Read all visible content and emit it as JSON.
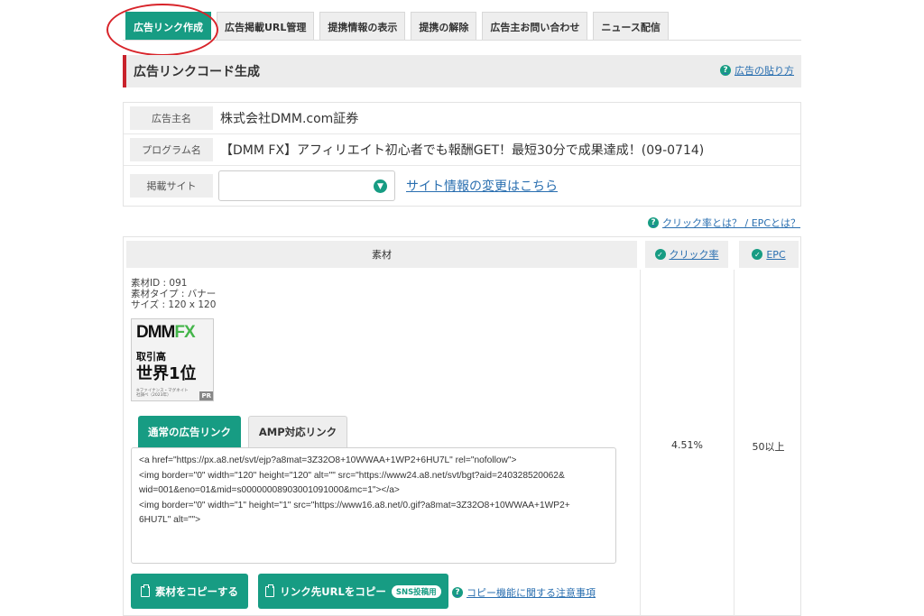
{
  "tabs": [
    {
      "label": "広告リンク作成",
      "active": true
    },
    {
      "label": "広告掲載URL管理"
    },
    {
      "label": "提携情報の表示"
    },
    {
      "label": "提携の解除"
    },
    {
      "label": "広告主お問い合わせ"
    },
    {
      "label": "ニュース配信"
    }
  ],
  "header": {
    "title": "広告リンクコード生成",
    "help_link": "広告の貼り方"
  },
  "info": {
    "advertiser_label": "広告主名",
    "advertiser_value": "株式会社DMM.com証券",
    "program_label": "プログラム名",
    "program_value": "【DMM FX】アフィリエイト初心者でも報酬GET！最短30分で成果達成！(09-0714)",
    "site_label": "掲載サイト",
    "site_value": "",
    "site_change_link": "サイト情報の変更はこちら"
  },
  "ctr_help_link": "クリック率とは？ / EPCとは？",
  "material_table": {
    "col_material": "素材",
    "col_ctr": "クリック率",
    "col_epc": "EPC",
    "meta": {
      "id": "素材ID : 091",
      "type": "素材タイプ : バナー",
      "size": "サイズ : 120 x 120"
    },
    "banner": {
      "logo_dmm": "DMM",
      "logo_fx": "FX",
      "line1": "取引高",
      "line2": "世界1位",
      "fine": "※ファイナンス・マグネイト社調べ（2023年）",
      "pr": "PR"
    },
    "link_tabs": [
      "通常の広告リンク",
      "AMP対応リンク"
    ],
    "code_lines": [
      "<a href=\"https://px.a8.net/svt/ejp?a8mat=3Z32O8+10WWAA+1WP2+6HU7L\" rel=\"nofollow\">",
      "<img border=\"0\" width=\"120\" height=\"120\" alt=\"\" src=\"https://www24.a8.net/svt/bgt?aid=240328520062&",
      "wid=001&eno=01&mid=s00000008903001091000&mc=1\"></a>",
      "<img border=\"0\" width=\"1\" height=\"1\" src=\"https://www16.a8.net/0.gif?a8mat=3Z32O8+10WWAA+1WP2+",
      "6HU7L\" alt=\"\">"
    ],
    "copy_material_button": "素材をコピーする",
    "copy_url_button": "リンク先URLをコピー",
    "sns_badge": "SNS投稿用",
    "copy_note_link": "コピー機能に関する注意事項",
    "ctr_value": "4.51%",
    "epc_value": "50以上"
  },
  "colors": {
    "accent": "#179c83",
    "header_bar": "#c8232c",
    "link": "#2a6fb0",
    "highlight_circle": "#d8242a"
  }
}
